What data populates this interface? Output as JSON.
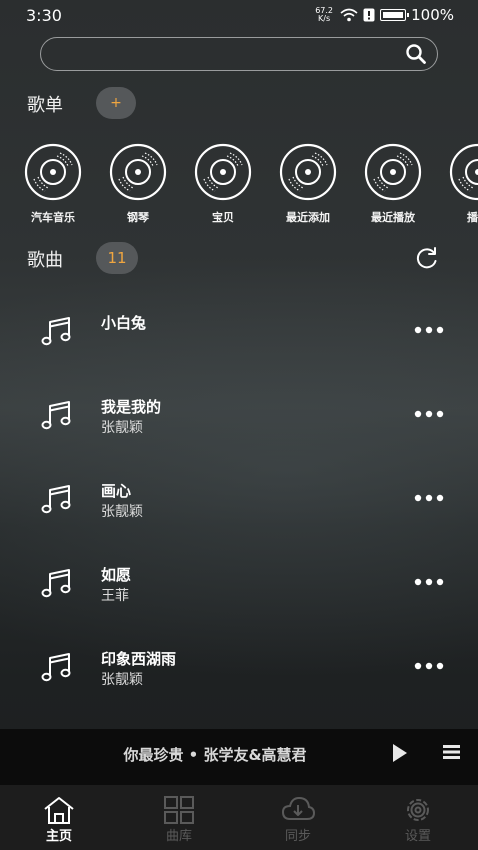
{
  "status_bar": {
    "time": "3:30",
    "net_speed_value": "67.2",
    "net_speed_unit": "K/s",
    "battery": "100%"
  },
  "search": {
    "placeholder": ""
  },
  "playlists_section": {
    "title": "歌单",
    "add_label": "+",
    "items": [
      {
        "label": "汽车音乐"
      },
      {
        "label": "钢琴"
      },
      {
        "label": "宝贝"
      },
      {
        "label": "最近添加"
      },
      {
        "label": "最近播放"
      },
      {
        "label": "播放"
      }
    ]
  },
  "songs_section": {
    "title": "歌曲",
    "count": "11",
    "songs": [
      {
        "title": "小白兔",
        "artist": ""
      },
      {
        "title": "我是我的",
        "artist": "张靓颖"
      },
      {
        "title": "画心",
        "artist": "张靓颖"
      },
      {
        "title": "如愿",
        "artist": "王菲"
      },
      {
        "title": "印象西湖雨",
        "artist": "张靓颖"
      }
    ]
  },
  "now_playing": {
    "text": "你最珍贵 • 张学友&高慧君"
  },
  "tab_bar": {
    "tabs": [
      {
        "label": "主页",
        "icon": "home-icon",
        "active": true
      },
      {
        "label": "曲库",
        "icon": "grid-icon",
        "active": false
      },
      {
        "label": "同步",
        "icon": "cloud-download-icon",
        "active": false
      },
      {
        "label": "设置",
        "icon": "gear-icon",
        "active": false
      }
    ]
  },
  "colors": {
    "accent": "#f0a640",
    "pill_bg": "#55585a",
    "player_bg": "#0c0c0c",
    "tabbar_bg": "#1d1d1d"
  }
}
